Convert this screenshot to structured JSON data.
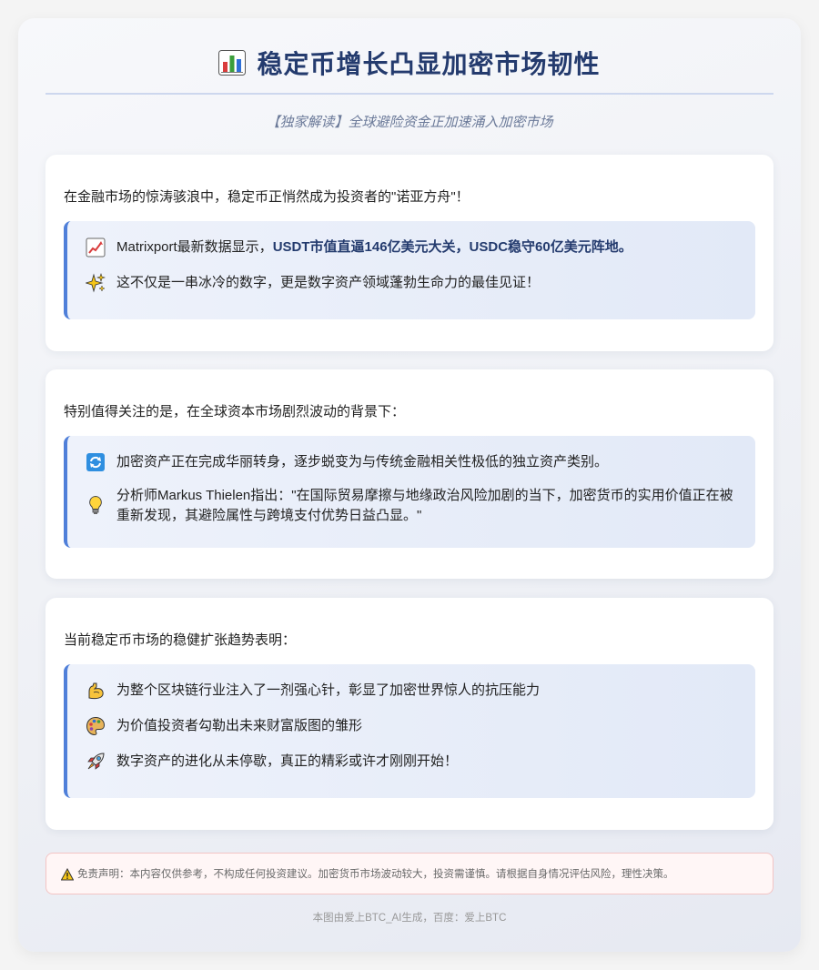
{
  "header": {
    "title": "稳定币增长凸显加密市场韧性",
    "title_icon": "bar-chart-icon",
    "subtitle": "【独家解读】全球避险资金正加速涌入加密市场"
  },
  "section1": {
    "intro": "在金融市场的惊涛骇浪中，稳定币正悄然成为投资者的\"诺亚方舟\"！",
    "items": [
      {
        "icon": "chart-increasing-icon",
        "prefix": "Matrixport最新数据显示，",
        "emphasis": "USDT市值直逼146亿美元大关，USDC稳守60亿美元阵地。"
      },
      {
        "icon": "sparkles-icon",
        "text": "这不仅是一串冰冷的数字，更是数字资产领域蓬勃生命力的最佳见证！"
      }
    ]
  },
  "section2": {
    "intro": "特别值得关注的是，在全球资本市场剧烈波动的背景下：",
    "items": [
      {
        "icon": "refresh-arrows-icon",
        "text": "加密资产正在完成华丽转身，逐步蜕变为与传统金融相关性极低的独立资产类别。"
      },
      {
        "icon": "light-bulb-icon",
        "text": "分析师Markus Thielen指出：\"在国际贸易摩擦与地缘政治风险加剧的当下，加密货币的实用价值正在被重新发现，其避险属性与跨境支付优势日益凸显。\""
      }
    ]
  },
  "section3": {
    "intro": "当前稳定币市场的稳健扩张趋势表明：",
    "items": [
      {
        "icon": "flexed-biceps-icon",
        "text": "为整个区块链行业注入了一剂强心针，彰显了加密世界惊人的抗压能力"
      },
      {
        "icon": "artist-palette-icon",
        "text": "为价值投资者勾勒出未来财富版图的雏形"
      },
      {
        "icon": "rocket-icon",
        "text": "数字资产的进化从未停歇，真正的精彩或许才刚刚开始！"
      }
    ]
  },
  "disclaimer": {
    "icon": "warning-icon",
    "text": "免责声明：本内容仅供参考，不构成任何投资建议。加密货币市场波动较大，投资需谨慎。请根据自身情况评估风险，理性决策。"
  },
  "footer": {
    "text": "本图由爱上BTC_AI生成，百度：爱上BTC"
  },
  "colors": {
    "title": "#243b6e",
    "accent_border": "#4f7fd9",
    "highlight_bg": "#e6ecf8",
    "disclaimer_border": "#f3c4c4"
  }
}
